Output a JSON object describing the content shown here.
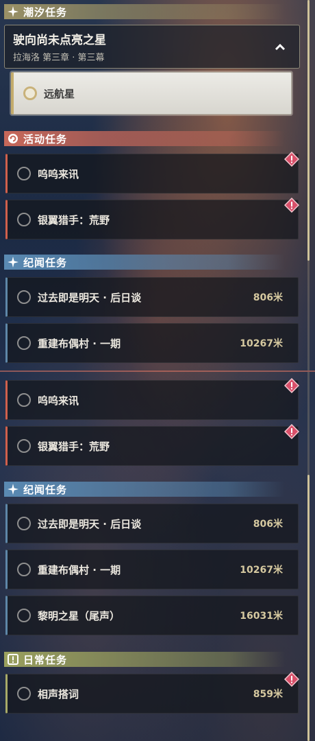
{
  "tide": {
    "header": "潮汐任务",
    "main_title": "驶向尚未点亮之星",
    "main_sub": "拉海洛 第三章 · 第三幕",
    "sub_quest": "远航星"
  },
  "event": {
    "header": "活动任务",
    "tasks": [
      {
        "label": "呜呜来讯"
      },
      {
        "label": "银翼猎手：荒野"
      }
    ]
  },
  "story": {
    "header": "纪闻任务",
    "tasks": [
      {
        "label": "过去即是明天 · 后日谈",
        "distance": "806米"
      },
      {
        "label": "重建布偶村 · 一期",
        "distance": "10267米"
      },
      {
        "label": "黎明之星（尾声）",
        "distance": "16031米"
      }
    ]
  },
  "daily": {
    "header": "日常任务",
    "tasks": [
      {
        "label": "相声搭词",
        "distance": "859米"
      }
    ]
  },
  "colors": {
    "tide": "#9a9166",
    "event": "#c7685a",
    "story": "#5a8ab3",
    "daily": "#9aa05e",
    "alert": "#d9506a"
  },
  "icons": {
    "tide": "sparkle-icon",
    "event": "refresh-icon",
    "story": "sparkle-icon",
    "daily": "exclamation-box-icon",
    "collapse": "chevron-up-icon",
    "alert": "alert-diamond-icon"
  }
}
